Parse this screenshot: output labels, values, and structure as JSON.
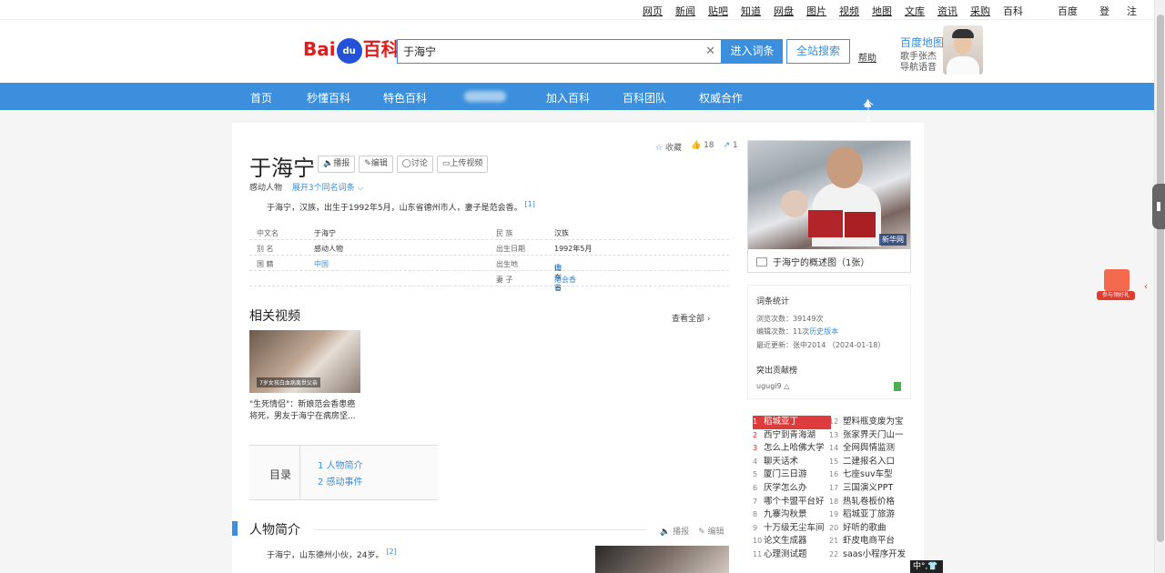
{
  "topbar": {
    "links": [
      "网页",
      "新闻",
      "贴吧",
      "知道",
      "网盘",
      "图片",
      "视频",
      "地图",
      "文库",
      "资讯",
      "采购",
      "百科"
    ],
    "right": [
      "百度首页",
      "登录",
      "注册"
    ]
  },
  "header": {
    "logo": "百科",
    "logo_prefix": "Bai",
    "logo_du": "du",
    "search_value": "于海宁",
    "clear_glyph": "✕",
    "enter_button": "进入词条",
    "all_search_button": "全站搜索",
    "help": "帮助",
    "ad_title": "百度地图",
    "ad_line1": "歌手张杰",
    "ad_line2": "导航语音"
  },
  "nav": {
    "items": [
      "首页",
      "秒懂百科",
      "特色百科",
      "加入百科",
      "百科团队",
      "权威合作"
    ],
    "user": "个人中心"
  },
  "entry": {
    "title": "于海宁",
    "tools": [
      "播报",
      "编辑",
      "讨论",
      "上传视频"
    ],
    "favorite": "收藏",
    "likes": "18",
    "shares": "1",
    "category": "感动人物",
    "expand": "展开3个同名词条",
    "summary": "于海宁，汉族，出生于1992年5月，山东省德州市人，妻子是范会香。",
    "summary_ref": "[1]",
    "info": {
      "left": [
        {
          "k": "中文名",
          "v": "于海宁",
          "link": false
        },
        {
          "k": "别    名",
          "v": "感动人物",
          "link": false
        },
        {
          "k": "国    籍",
          "v": "中国",
          "link": true
        }
      ],
      "right": [
        {
          "k": "民    族",
          "v": "汉族",
          "link": false
        },
        {
          "k": "出生日期",
          "v": "1992年5月",
          "link": false
        },
        {
          "k": "出生地",
          "v_plain": "山东省",
          "v_link": "德州市"
        },
        {
          "k": "妻    子",
          "v": "范会香",
          "link": true
        }
      ]
    },
    "videos_heading": "相关视频",
    "see_all": "查看全部",
    "video_caption": "\"生死情侣\"：新娘范会香患癌将死，男友于海宁在病房坚...",
    "video_thumb_text": "7岁女孩白血病离世父亲",
    "toc_label": "目录",
    "toc": [
      "1  人物简介",
      "2  感动事件"
    ],
    "section_title": "人物简介",
    "section_tools": [
      "播报",
      "编辑"
    ],
    "intro": "于海宁，山东德州小伙，24岁。",
    "intro_ref": "[2]"
  },
  "side": {
    "photo_caption": "于海宁的概述图（1张）",
    "photo_badge": "新华网",
    "stats_heading": "词条统计",
    "views": "浏览次数：39149次",
    "edits_prefix": "编辑次数：11次",
    "history_link": "历史版本",
    "updated": "最近更新：张中2014 （2024-01-18）",
    "contrib_heading": "突出贡献榜",
    "contributor": "ugugi9",
    "hot_left": [
      {
        "n": "1",
        "t": "稻城亚丁"
      },
      {
        "n": "2",
        "t": "西宁到青海湖"
      },
      {
        "n": "3",
        "t": "怎么上哈佛大学"
      },
      {
        "n": "4",
        "t": "聊天话术"
      },
      {
        "n": "5",
        "t": "厦门三日游"
      },
      {
        "n": "6",
        "t": "厌学怎么办"
      },
      {
        "n": "7",
        "t": "哪个卡盟平台好"
      },
      {
        "n": "8",
        "t": "九寨沟秋景"
      },
      {
        "n": "9",
        "t": "十万级无尘车间"
      },
      {
        "n": "10",
        "t": "论文生成器"
      },
      {
        "n": "11",
        "t": "心理测试题"
      }
    ],
    "hot_right": [
      {
        "n": "12",
        "t": "塑料瓶变废为宝"
      },
      {
        "n": "13",
        "t": "张家界天门山一"
      },
      {
        "n": "14",
        "t": "全网舆情监测"
      },
      {
        "n": "15",
        "t": "二建报名入口"
      },
      {
        "n": "16",
        "t": "七座suv车型"
      },
      {
        "n": "17",
        "t": "三国演义PPT"
      },
      {
        "n": "18",
        "t": "热轧卷板价格"
      },
      {
        "n": "19",
        "t": "稻城亚丁旅游"
      },
      {
        "n": "20",
        "t": "好听的歌曲"
      },
      {
        "n": "21",
        "t": "虾皮电商平台"
      },
      {
        "n": "22",
        "t": "saas小程序开发"
      }
    ]
  },
  "widgets": {
    "gift_label": "参与领好礼",
    "ime": "中°,👕"
  },
  "colors": {
    "accent": "#3b8fdc",
    "brand_red": "#de1e1e"
  }
}
